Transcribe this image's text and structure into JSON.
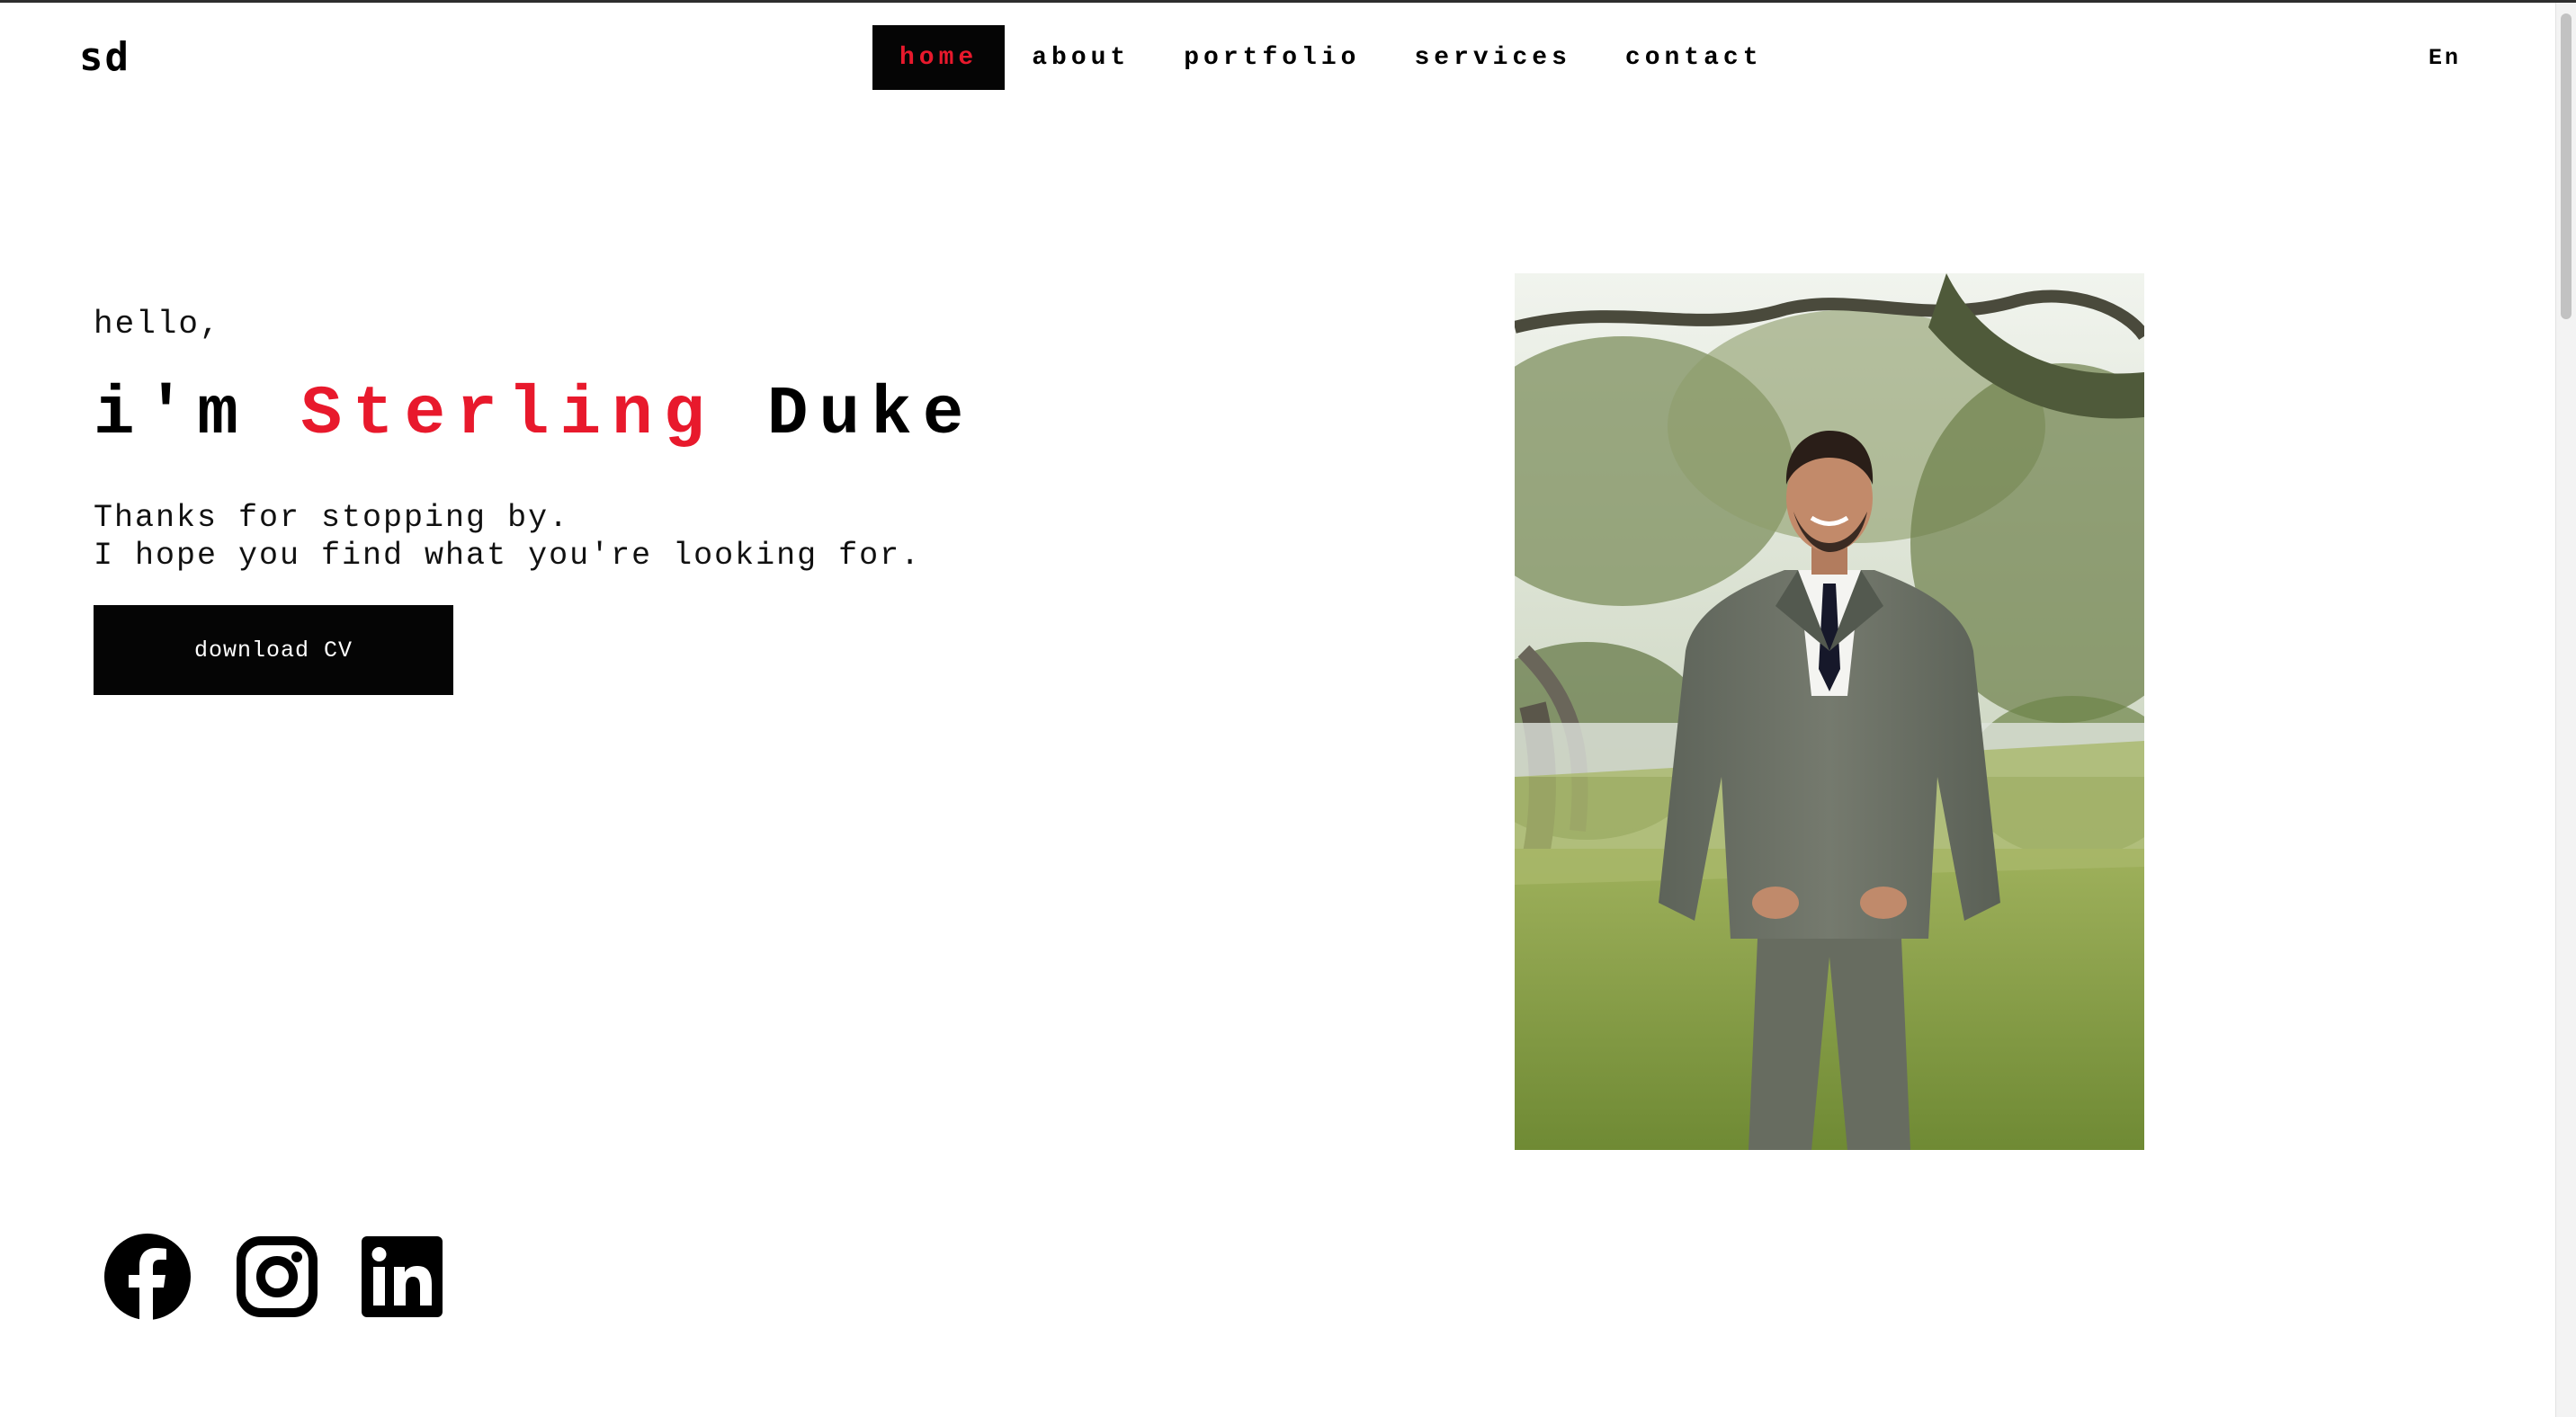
{
  "brand": {
    "logo_text": "sd"
  },
  "nav": {
    "items": [
      {
        "label": "home",
        "active": true
      },
      {
        "label": "about",
        "active": false
      },
      {
        "label": "portfolio",
        "active": false
      },
      {
        "label": "services",
        "active": false
      },
      {
        "label": "contact",
        "active": false
      }
    ],
    "language": "En"
  },
  "hero": {
    "greeting": "hello,",
    "intro": "i'm",
    "first_name": "Sterling",
    "last_name": "Duke",
    "line1": "Thanks for stopping by.",
    "line2": "I hope you find what you're looking for.",
    "cta_label": "download CV"
  },
  "portrait": {
    "icon": "portrait-photo"
  },
  "socials": [
    {
      "name": "Facebook",
      "icon": "facebook-icon"
    },
    {
      "name": "Instagram",
      "icon": "instagram-icon"
    },
    {
      "name": "LinkedIn",
      "icon": "linkedin-icon"
    }
  ],
  "colors": {
    "accent": "#e8192c",
    "dark": "#050505",
    "background": "#ffffff"
  }
}
